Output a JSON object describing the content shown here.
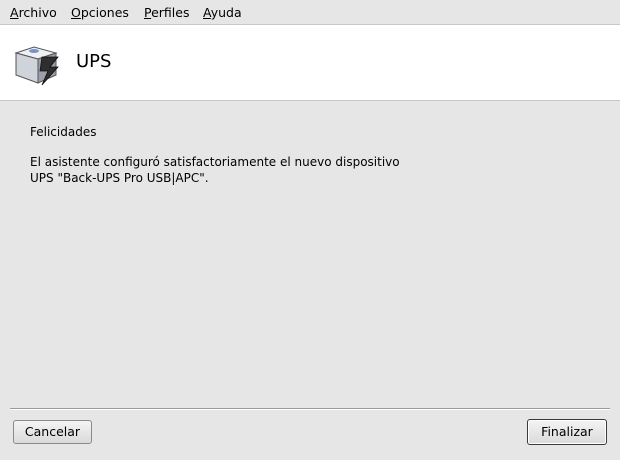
{
  "menu": {
    "archivo": {
      "mnemonic": "A",
      "rest": "rchivo"
    },
    "opciones": {
      "mnemonic": "O",
      "rest": "pciones"
    },
    "perfiles": {
      "mnemonic": "P",
      "rest": "erfiles"
    },
    "ayuda": {
      "mnemonic": "A",
      "rest": "yuda"
    }
  },
  "header": {
    "icon": "ups-device-icon",
    "title": "UPS"
  },
  "content": {
    "heading": "Felicidades",
    "line1": "El asistente configuró satisfactoriamente el nuevo dispositivo",
    "line2": "UPS \"Back-UPS Pro USB|APC\"."
  },
  "buttons": {
    "cancel": "Cancelar",
    "finish": "Finalizar"
  }
}
